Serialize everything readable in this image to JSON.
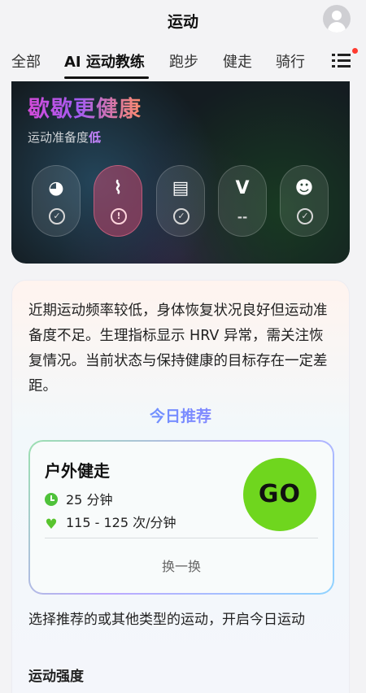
{
  "header": {
    "title": "运动"
  },
  "tabs": [
    {
      "label": "全部"
    },
    {
      "label": "AI 运动教练"
    },
    {
      "label": "跑步"
    },
    {
      "label": "健走"
    },
    {
      "label": "骑行"
    }
  ],
  "readiness_card": {
    "headline": "歇歇更健康",
    "readiness_label": "运动准备度",
    "readiness_level": "低",
    "indicators": [
      {
        "icon": "sleep-moon-icon",
        "glyph": "◕",
        "status": "✓"
      },
      {
        "icon": "heart-rate-wave-icon",
        "glyph": "⌇",
        "status": "!"
      },
      {
        "icon": "report-document-icon",
        "glyph": "▤",
        "status": "✓"
      },
      {
        "icon": "vitality-v-icon",
        "glyph": "V",
        "status": "--"
      },
      {
        "icon": "mood-face-icon",
        "glyph": "☻",
        "status": "✓"
      }
    ]
  },
  "recommendation": {
    "summary": "近期运动频率较低，身体恢复状况良好但运动准备度不足。生理指标显示 HRV 异常，需关注恢复情况。当前状态与保持健康的目标存在一定差距。",
    "today_title": "今日推荐",
    "activity": {
      "name": "户外健走",
      "duration": "25 分钟",
      "heart_rate": "115 - 125 次/分钟",
      "go_label": "GO",
      "swap_label": "换一换"
    },
    "hint": "选择推荐的或其他类型的运动，开启今日运动",
    "intensity_label": "运动强度"
  },
  "colors": {
    "accent_green": "#6fd61e",
    "alert_pink": "#e24a74",
    "readiness_purple": "#c785ff"
  }
}
